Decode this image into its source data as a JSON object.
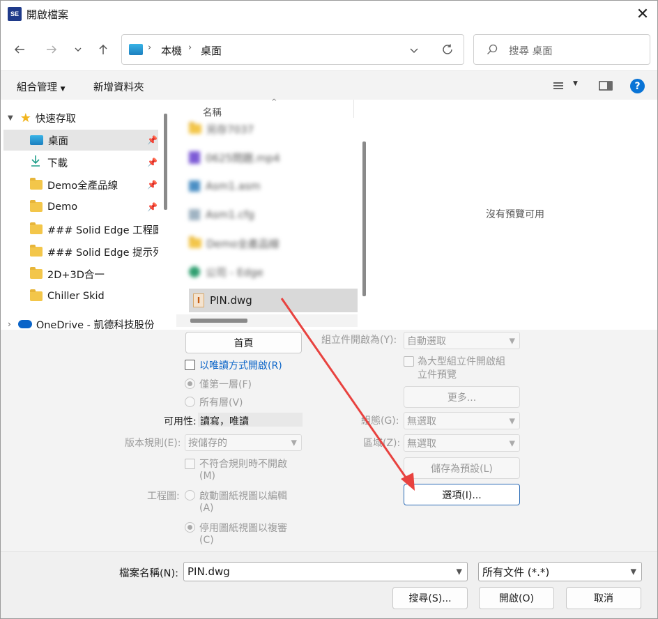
{
  "window": {
    "title": "開啟檔案",
    "app_icon": "SE"
  },
  "address": {
    "segments": [
      "本機",
      "桌面"
    ]
  },
  "search": {
    "placeholder": "搜尋 桌面"
  },
  "toolbar": {
    "organize": "組合管理",
    "new_folder": "新增資料夾"
  },
  "nav": {
    "quick_access": "快速存取",
    "items": [
      {
        "label": "桌面",
        "pinned": true
      },
      {
        "label": "下載",
        "pinned": true
      },
      {
        "label": "Demo全產品線",
        "pinned": true
      },
      {
        "label": "Demo",
        "pinned": true
      },
      {
        "label": "### Solid Edge 工程圖",
        "pinned": false
      },
      {
        "label": "### Solid Edge 提示列",
        "pinned": false
      },
      {
        "label": "2D+3D合一",
        "pinned": false
      },
      {
        "label": "Chiller Skid",
        "pinned": false
      }
    ],
    "onedrive": "OneDrive - 凱德科技股份"
  },
  "files": {
    "column_name": "名稱",
    "blurred_rows": [
      "另存7037",
      "0625問題.mp4",
      "Asm1.asm",
      "Asm1.cfg",
      "Demo全產品線",
      "公司 - Edge"
    ],
    "selected": "PIN.dwg"
  },
  "preview": {
    "text": "沒有預覽可用"
  },
  "options": {
    "home_button": "首頁",
    "readonly": "以唯讀方式開啟(R)",
    "first_level": "僅第一層(F)",
    "all_levels": "所有層(V)",
    "availability_label": "可用性:",
    "availability_value": "讀寫，唯讀",
    "version_rule_label": "版本規則(E):",
    "version_rule_value": "按儲存的",
    "no_open_nonconform_1": "不符合規則時不開啟",
    "no_open_nonconform_2": "(M)",
    "drawing_label": "工程圖:",
    "enable_drawing_1": "啟動圖紙視圖以編輯",
    "enable_drawing_2": "(A)",
    "disable_drawing_1": "停用圖紙視圖以複審",
    "disable_drawing_2": "(C)",
    "assembly_open_as_label": "組立件開啟為(Y):",
    "assembly_open_as_value": "自動選取",
    "large_asm_1": "為大型組立件開啟組",
    "large_asm_2": "立件預覽",
    "more": "更多...",
    "config_label": "組態(G):",
    "config_value": "無選取",
    "zone_label": "區域(Z):",
    "zone_value": "無選取",
    "save_default": "儲存為預設(L)",
    "options_button": "選項(I)..."
  },
  "bottom": {
    "filename_label": "檔案名稱(N):",
    "filename_value": "PIN.dwg",
    "filter_value": "所有文件 (*.*)",
    "search_button": "搜尋(S)...",
    "open_button": "開啟(O)",
    "cancel_button": "取消"
  },
  "colors": {
    "accent": "#0067c0",
    "arrow": "#e8423f",
    "selection": "#e5e5e5"
  }
}
